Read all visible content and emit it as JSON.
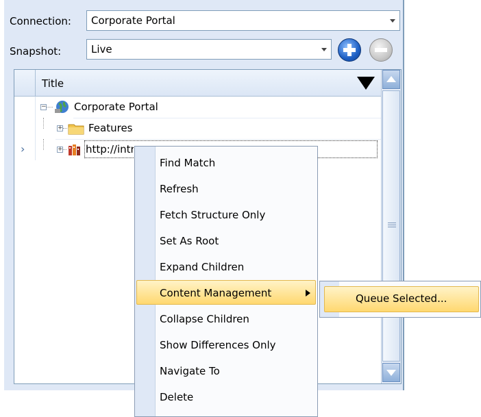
{
  "connection": {
    "label": "Connection:",
    "value": "Corporate Portal"
  },
  "snapshot": {
    "label": "Snapshot:",
    "value": "Live"
  },
  "grid": {
    "column_title": "Title",
    "rows": [
      {
        "label": "Corporate Portal",
        "icon": "globe-icon"
      },
      {
        "label": "Features",
        "icon": "folder-icon"
      },
      {
        "label": "http://intranet.offi...",
        "icon": "site-icon"
      }
    ]
  },
  "context_menu": {
    "items": [
      "Find Match",
      "Refresh",
      "Fetch Structure Only",
      "Set As Root",
      "Expand Children",
      "Content Management",
      "Collapse Children",
      "Show Differences Only",
      "Navigate To",
      "Delete"
    ],
    "submenu": {
      "item": "Queue Selected..."
    }
  },
  "colors": {
    "panel": "#dfe8f6",
    "highlight": "#ffd870",
    "accent_blue": "#1d5fc4"
  }
}
